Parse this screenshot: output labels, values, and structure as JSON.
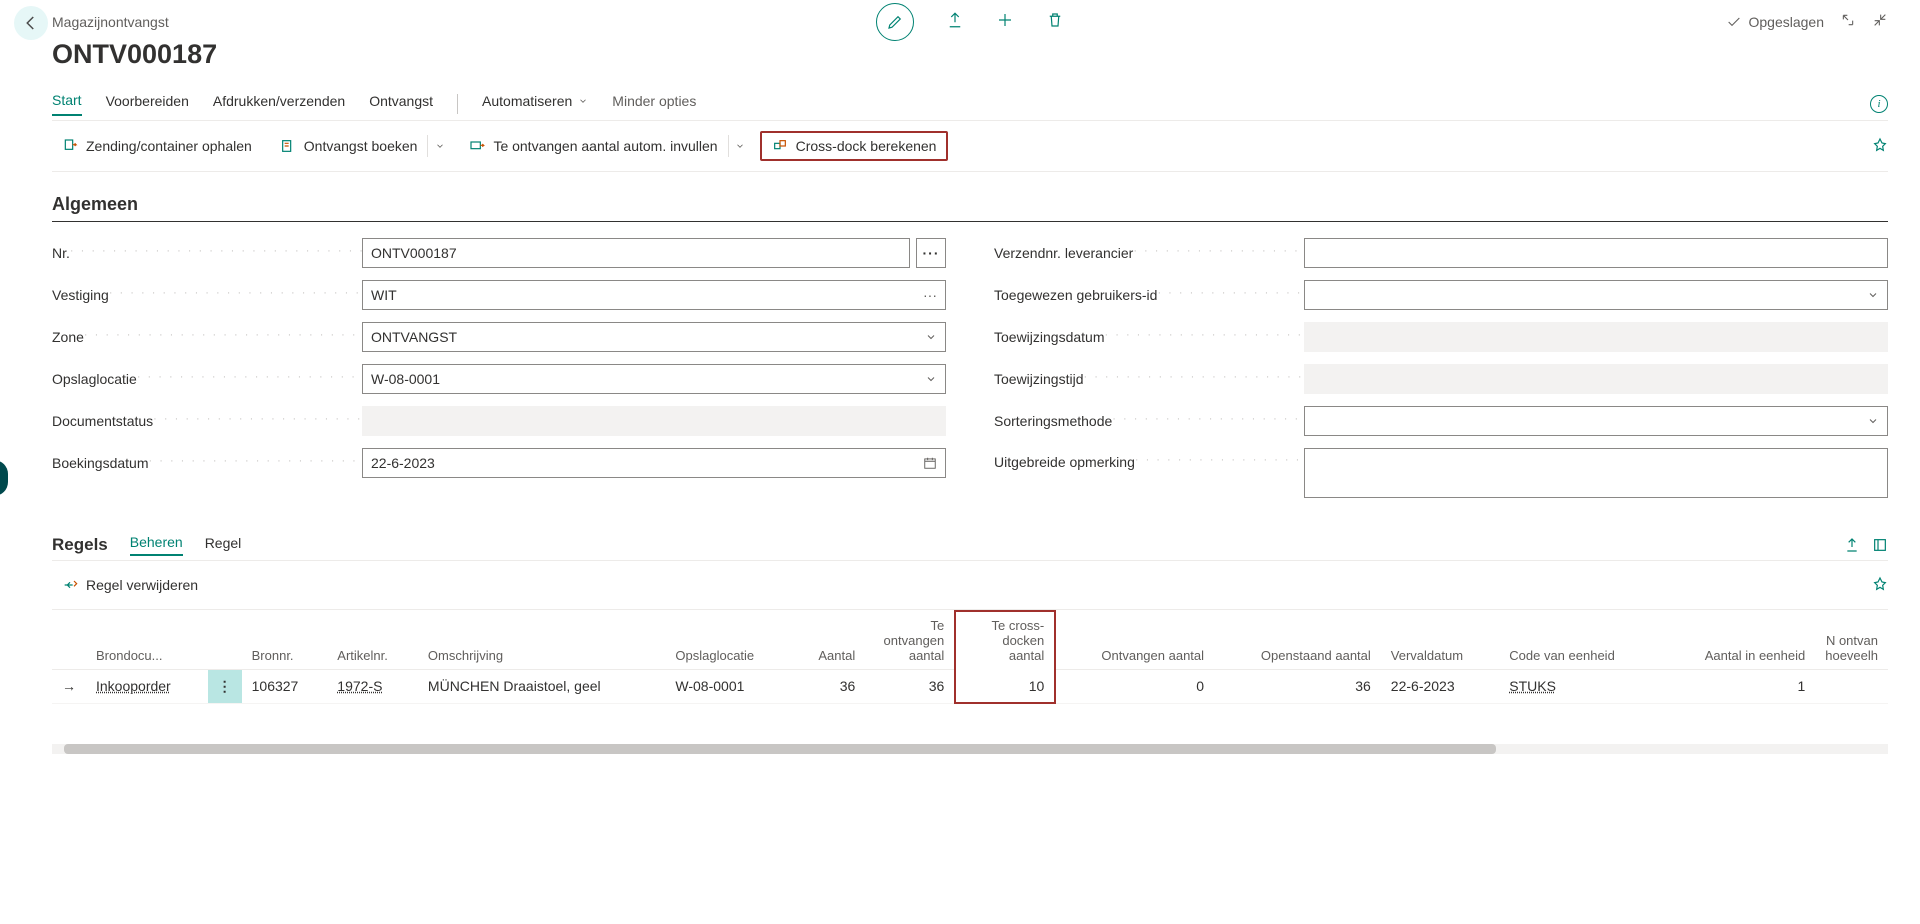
{
  "header": {
    "breadcrumb": "Magazijnontvangst",
    "title": "ONTV000187",
    "saved_label": "Opgeslagen"
  },
  "tabs": {
    "start": "Start",
    "voorbereiden": "Voorbereiden",
    "afdrukken": "Afdrukken/verzenden",
    "ontvangst": "Ontvangst",
    "automatiseren": "Automatiseren",
    "minder": "Minder opties"
  },
  "actions": {
    "zending": "Zending/container ophalen",
    "boeken": "Ontvangst boeken",
    "invullen": "Te ontvangen aantal autom. invullen",
    "crossdock": "Cross-dock berekenen"
  },
  "section_general": "Algemeen",
  "fields": {
    "nr_label": "Nr.",
    "nr_value": "ONTV000187",
    "vestiging_label": "Vestiging",
    "vestiging_value": "WIT",
    "zone_label": "Zone",
    "zone_value": "ONTVANGST",
    "opslag_label": "Opslaglocatie",
    "opslag_value": "W-08-0001",
    "docstatus_label": "Documentstatus",
    "docstatus_value": "",
    "boekings_label": "Boekingsdatum",
    "boekings_value": "22-6-2023",
    "verzend_label": "Verzendnr. leverancier",
    "verzend_value": "",
    "toegewezen_label": "Toegewezen gebruikers-id",
    "toegewezen_value": "",
    "toewijzingsdatum_label": "Toewijzingsdatum",
    "toewijzingsdatum_value": "",
    "toewijzingstijd_label": "Toewijzingstijd",
    "toewijzingstijd_value": "",
    "sortering_label": "Sorteringsmethode",
    "sortering_value": "",
    "opmerking_label": "Uitgebreide opmerking",
    "opmerking_value": ""
  },
  "lines": {
    "title": "Regels",
    "tab_beheren": "Beheren",
    "tab_regel": "Regel",
    "action_delete": "Regel verwijderen",
    "columns": {
      "brondoc": "Brondocu...",
      "bronnr": "Bronnr.",
      "artikelnr": "Artikelnr.",
      "omschrijving": "Omschrijving",
      "opslag": "Opslaglocatie",
      "aantal": "Aantal",
      "teontvangen": "Te ontvangen aantal",
      "tecross": "Te cross-docken aantal",
      "ontvangen": "Ontvangen aantal",
      "openstaand": "Openstaand aantal",
      "vervaldatum": "Vervaldatum",
      "codevan": "Code van eenheid",
      "aantalin": "Aantal in eenheid",
      "ontvanh": "N ontvan hoeveelh"
    },
    "rows": [
      {
        "brondoc": "Inkooporder",
        "bronnr": "106327",
        "artikelnr": "1972-S",
        "omschrijving": "MÜNCHEN Draaistoel, geel",
        "opslag": "W-08-0001",
        "aantal": "36",
        "teontvangen": "36",
        "tecross": "10",
        "ontvangen": "0",
        "openstaand": "36",
        "vervaldatum": "22-6-2023",
        "codevan": "STUKS",
        "aantalin": "1"
      }
    ]
  }
}
